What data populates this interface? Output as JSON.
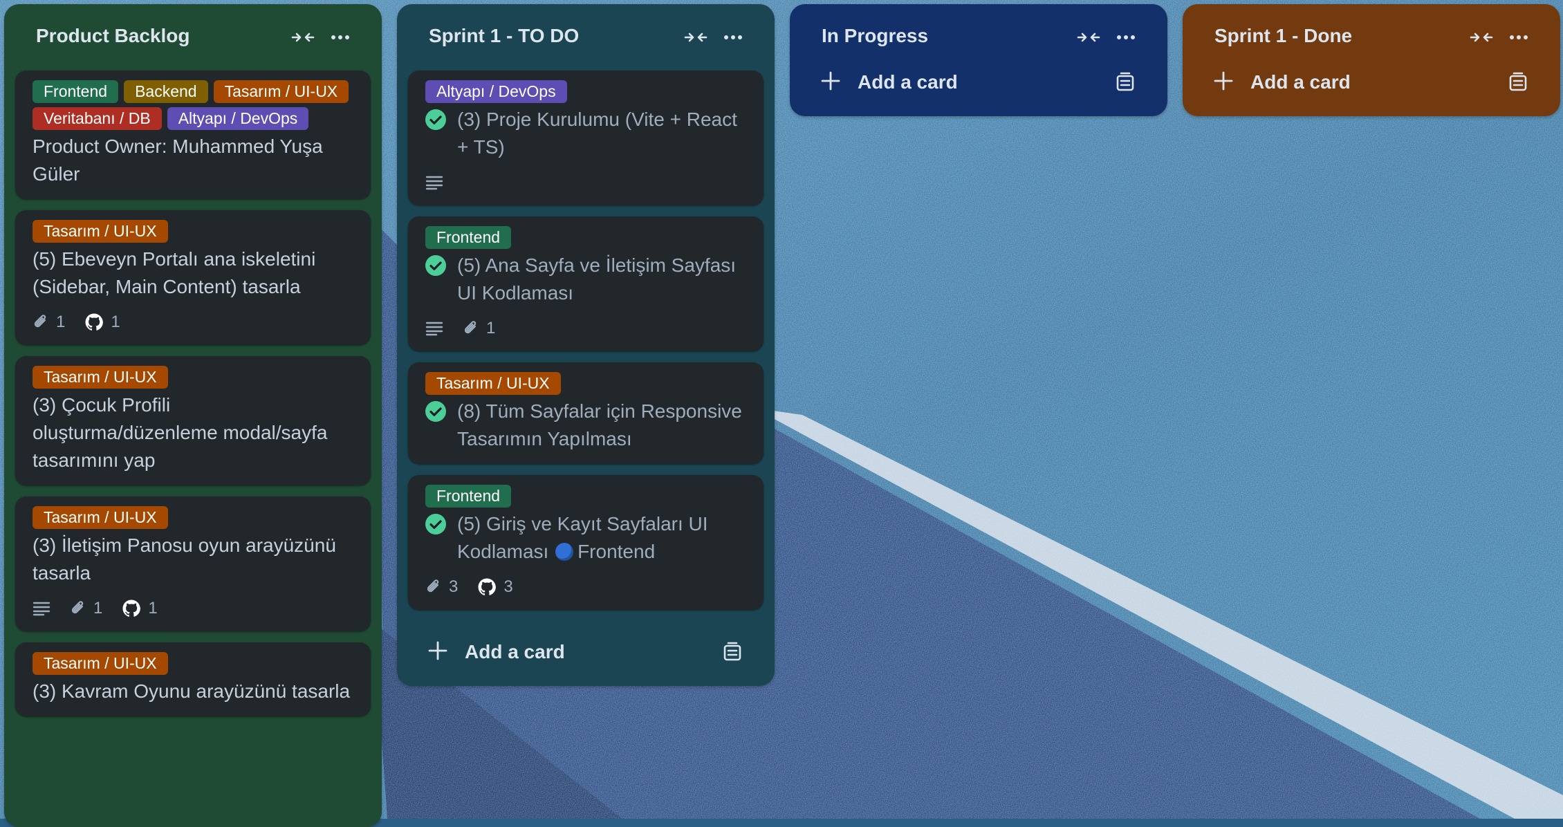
{
  "board": {
    "lists": [
      {
        "title": "Product Backlog",
        "cards": [
          {
            "labels": [
              {
                "text": "Frontend",
                "color": "#216e4e"
              },
              {
                "text": "Backend",
                "color": "#7f5f01"
              },
              {
                "text": "Tasarım / UI-UX",
                "color": "#a54800"
              },
              {
                "text": "Veritabanı / DB",
                "color": "#ae2e24"
              },
              {
                "text": "Altyapı / DevOps",
                "color": "#5e4db2"
              }
            ],
            "title": "Product Owner: Muhammed Yuşa Güler"
          },
          {
            "labels": [
              {
                "text": "Tasarım / UI-UX",
                "color": "#a54800"
              }
            ],
            "title": "(5) Ebeveyn Portalı ana iskeletini (Sidebar, Main Content) tasarla",
            "attachments": "1",
            "github": "1"
          },
          {
            "labels": [
              {
                "text": "Tasarım / UI-UX",
                "color": "#a54800"
              }
            ],
            "title": "(3) Çocuk Profili oluşturma/düzenleme modal/sayfa tasarımını yap"
          },
          {
            "labels": [
              {
                "text": "Tasarım / UI-UX",
                "color": "#a54800"
              }
            ],
            "title": "(3) İletişim Panosu oyun arayüzünü tasarla",
            "attachments": "1",
            "github": "1"
          },
          {
            "labels": [
              {
                "text": "Tasarım / UI-UX",
                "color": "#a54800"
              }
            ],
            "title": "(3) Kavram Oyunu arayüzünü tasarla"
          }
        ]
      },
      {
        "title": "Sprint 1 - TO DO",
        "cards": [
          {
            "labels": [
              {
                "text": "Altyapı / DevOps",
                "color": "#5e4db2"
              }
            ],
            "title": "(3) Proje Kurulumu (Vite + React + TS)"
          },
          {
            "labels": [
              {
                "text": "Frontend",
                "color": "#216e4e"
              }
            ],
            "title": "(5) Ana Sayfa ve İletişim Sayfası UI Kodlaması",
            "attachments": "1"
          },
          {
            "labels": [
              {
                "text": "Tasarım / UI-UX",
                "color": "#a54800"
              }
            ],
            "title": "(8) Tüm Sayfalar için Responsive Tasarımın Yapılması"
          },
          {
            "labels": [
              {
                "text": "Frontend",
                "color": "#216e4e"
              }
            ],
            "title": "(5) Giriş ve Kayıt Sayfaları UI Kodlaması",
            "title_suffix": "Frontend",
            "attachments": "3",
            "github": "3"
          }
        ],
        "add_card": "Add a card"
      },
      {
        "title": "In Progress",
        "add_card": "Add a card"
      },
      {
        "title": "Sprint 1 - Done",
        "add_card": "Add a card"
      }
    ],
    "colors": {
      "backlog_bg": "#1f4a33",
      "todo_bg": "#1b4552",
      "inprogress_bg": "#14306b",
      "done_bg": "#733a10",
      "card_bg": "#22272b",
      "check": "#4bce97"
    }
  }
}
